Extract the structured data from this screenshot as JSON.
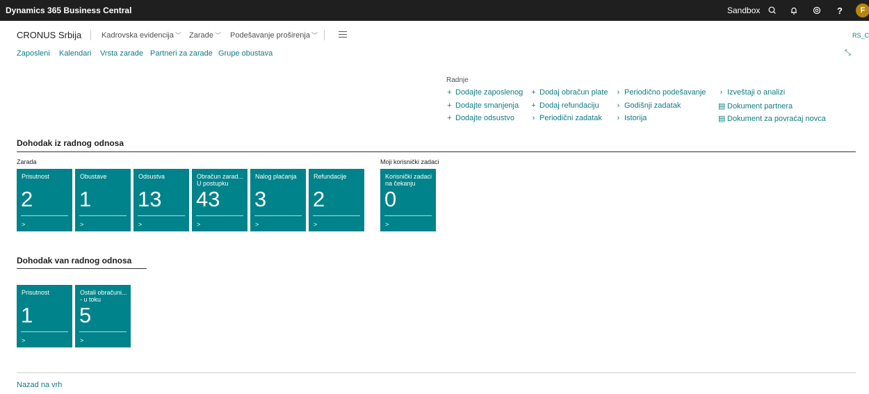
{
  "topbar": {
    "brand": "Dynamics 365 Business Central",
    "environment": "Sandbox",
    "avatar_initial": "F",
    "icons": [
      "search-icon",
      "bell-icon",
      "gear-icon",
      "help-icon"
    ]
  },
  "header": {
    "company": "CRONUS Srbija",
    "menus": [
      {
        "label": "Kadrovska evidencija"
      },
      {
        "label": "Zarade"
      },
      {
        "label": "Podešavanje proširenja"
      }
    ],
    "profile": "RS_C"
  },
  "nav": {
    "links": [
      "Zaposleni",
      "Kalendari",
      "Vrsta zarade",
      "Partneri za zarade",
      "Grupe obustava"
    ]
  },
  "actions": {
    "title": "Radnje",
    "items": [
      {
        "prefix": "+",
        "label": "Dodajte zaposlenog"
      },
      {
        "prefix": "+",
        "label": "Dodajte smanjenja"
      },
      {
        "prefix": "+",
        "label": "Dodajte odsustvo"
      },
      {
        "prefix": "+",
        "label": "Dodaj obračun plate"
      },
      {
        "prefix": "+",
        "label": "Dodaj refundaciju"
      },
      {
        "prefix": "›",
        "label": "Periodični zadatak"
      },
      {
        "prefix": "›",
        "label": "Periodično podešavanje"
      },
      {
        "prefix": "›",
        "label": "Godišnji zadatak"
      },
      {
        "prefix": "›",
        "label": "Istorija"
      },
      {
        "prefix": "›",
        "label": "Izveštaji o analizi"
      },
      {
        "prefix": "▤",
        "label": "Dokument partnera"
      },
      {
        "prefix": "▤",
        "label": "Dokument za povraćaj novca"
      }
    ]
  },
  "section1": {
    "title": "Dohodak iz radnog odnosa",
    "group1": {
      "title": "Zarada",
      "tiles": [
        {
          "label": "Prisutnost",
          "value": "2"
        },
        {
          "label": "Obustave",
          "value": "1"
        },
        {
          "label": "Odsustva",
          "value": "13"
        },
        {
          "label": "Obračun zarad...\nU postupku",
          "value": "43"
        },
        {
          "label": "Nalog plaćanja",
          "value": "3"
        },
        {
          "label": "Refundacije",
          "value": "2"
        }
      ]
    },
    "group2": {
      "title": "Moji korisnički zadaci",
      "tiles": [
        {
          "label": "Korisnički zadaci\nna čekanju",
          "value": "0"
        }
      ]
    }
  },
  "section2": {
    "title": "Dohodak van radnog odnosa",
    "tiles": [
      {
        "label": "Prisutnost",
        "value": "1"
      },
      {
        "label": "Ostali obračuni...\n- u toku",
        "value": "5"
      }
    ]
  },
  "footer": {
    "back_to_top": "Nazad na vrh"
  },
  "colors": {
    "topbar": "#1f1f1f",
    "tile": "#00838a",
    "link": "#0f7b83",
    "avatar": "#b8860b"
  }
}
